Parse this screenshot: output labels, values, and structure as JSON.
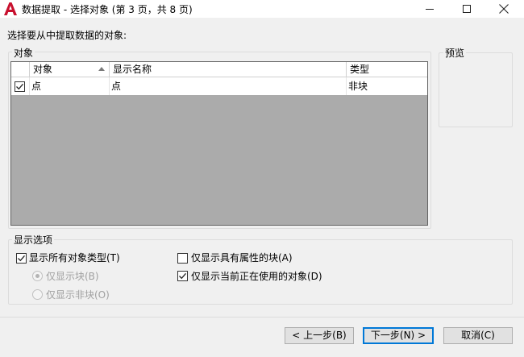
{
  "window": {
    "title": "数据提取 - 选择对象 (第 3 页，共 8 页)",
    "icons": {
      "app": "autocad-a-icon",
      "minimize": "minimize-icon",
      "maximize": "maximize-icon",
      "close": "close-icon"
    },
    "accent_color": "#0078d7",
    "logo_color": "#c8102e"
  },
  "prompt": "选择要从中提取数据的对象:",
  "objects_group": {
    "label": "对象",
    "columns": [
      "对象",
      "显示名称",
      "类型"
    ],
    "sort_column": "对象",
    "sort_direction": "ascending",
    "rows": [
      {
        "checked": true,
        "object": "点",
        "display_name": "点",
        "type": "非块"
      }
    ]
  },
  "preview_group": {
    "label": "预览"
  },
  "display_options": {
    "label": "显示选项",
    "show_all_types": {
      "label": "显示所有对象类型(T)",
      "checked": true
    },
    "blocks_only": {
      "label": "仅显示块(B)",
      "selected": true,
      "enabled": false
    },
    "non_blocks_only": {
      "label": "仅显示非块(O)",
      "selected": false,
      "enabled": false
    },
    "blocks_with_attributes": {
      "label": "仅显示具有属性的块(A)",
      "checked": false
    },
    "objects_in_use": {
      "label": "仅显示当前正在使用的对象(D)",
      "checked": true
    }
  },
  "buttons": {
    "back": "< 上一步(B)",
    "next": "下一步(N) >",
    "cancel": "取消(C)"
  }
}
